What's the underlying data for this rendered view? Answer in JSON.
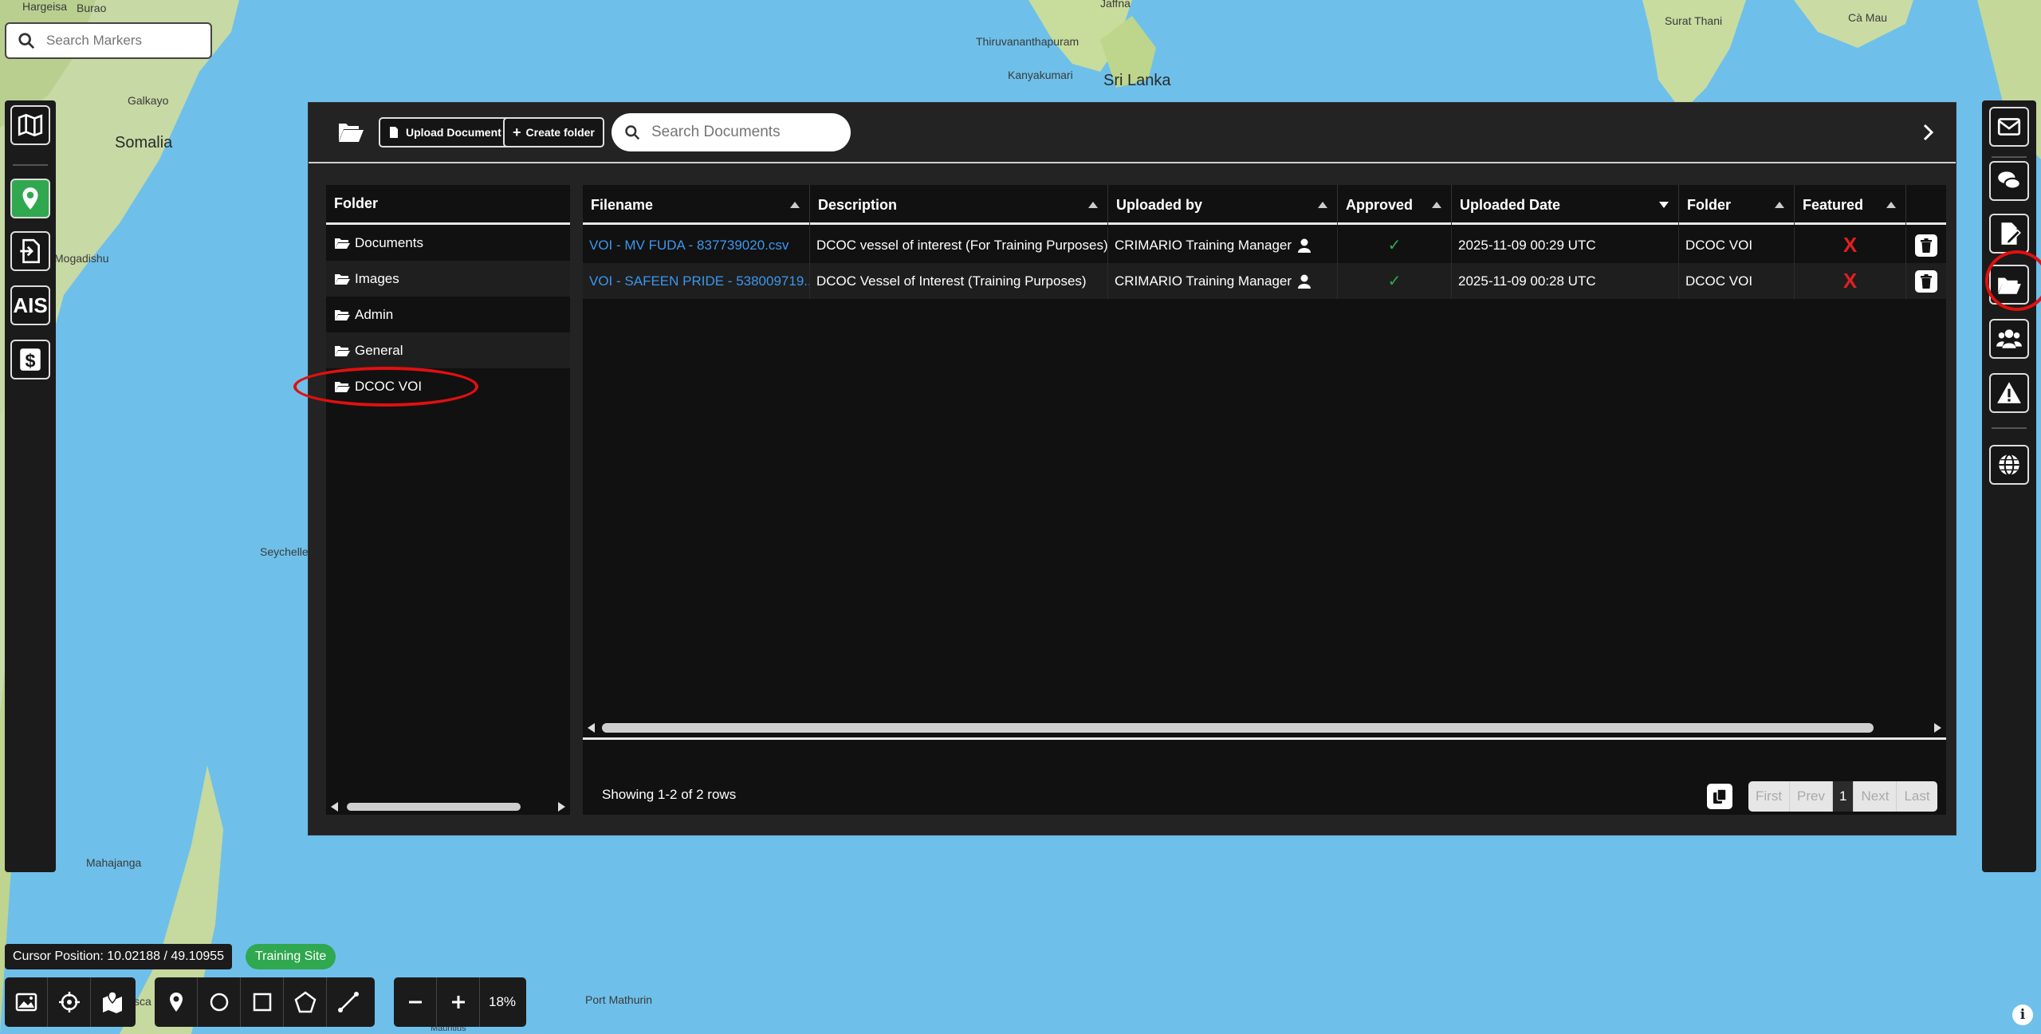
{
  "map": {
    "labels": {
      "hargeisa": "Hargeisa",
      "burao": "Burao",
      "galkayo": "Galkayo",
      "somalia": "Somalia",
      "mogadishu": "Mogadishu",
      "seychelles": "Seychelle",
      "mahajanga": "Mahajanga",
      "port_mathurin": "Port Mathurin",
      "thiruvananthapuram": "Thiruvananthapuram",
      "kanyakumari": "Kanyakumari",
      "sri_lanka": "Sri Lanka",
      "jaffna": "Jaffna",
      "surat_thani": "Surat Thani",
      "ca_mau": "Cà Mau",
      "fragment_sca": "sca",
      "fragment_mauritius": "Mauritius"
    }
  },
  "marker_search": {
    "placeholder": "Search Markers"
  },
  "panel": {
    "upload_label": "Upload Document",
    "create_folder_label": "Create folder",
    "search_placeholder": "Search Documents",
    "folder_header": "Folder",
    "folders": [
      "Documents",
      "Images",
      "Admin",
      "General",
      "DCOC VOI"
    ]
  },
  "table": {
    "columns": [
      "Filename",
      "Description",
      "Uploaded by",
      "Approved",
      "Uploaded Date",
      "Folder",
      "Featured"
    ],
    "rows": [
      {
        "filename": "VOI - MV FUDA - 837739020.csv",
        "description": "DCOC vessel of interest (For Training Purposes)",
        "uploaded_by": "CRIMARIO Training Manager",
        "approved": "✓",
        "date": "2025-11-09 00:29 UTC",
        "folder": "DCOC VOI",
        "featured": "X"
      },
      {
        "filename": "VOI - SAFEEN PRIDE - 538009719....",
        "description": "DCOC Vessel of Interest (Training Purposes)",
        "uploaded_by": "CRIMARIO Training Manager",
        "approved": "✓",
        "date": "2025-11-09 00:28 UTC",
        "folder": "DCOC VOI",
        "featured": "X"
      }
    ],
    "row_count": "Showing 1-2 of 2 rows",
    "pager": {
      "first": "First",
      "prev": "Prev",
      "current": "1",
      "next": "Next",
      "last": "Last"
    }
  },
  "status": {
    "cursor_position": "Cursor Position: 10.02188 / 49.10955",
    "site_badge": "Training Site",
    "zoom": "18%"
  },
  "left_toolbar": {
    "ais_label": "AIS"
  },
  "colors": {
    "accent_green": "#2fa84f",
    "link_blue": "#3c97ef",
    "annotation_red": "#e01010"
  }
}
